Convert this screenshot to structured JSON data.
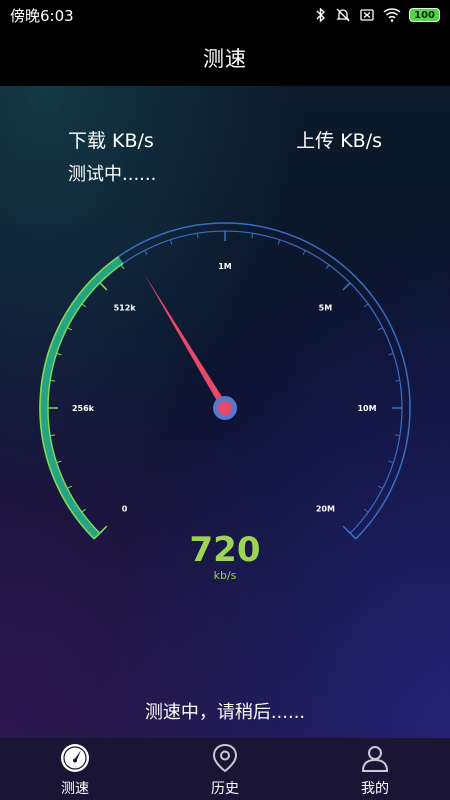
{
  "status_bar": {
    "time": "傍晚6:03",
    "battery": "100",
    "icons": [
      "bluetooth-icon",
      "mute-icon",
      "sim-off-icon",
      "wifi-icon",
      "battery-icon"
    ]
  },
  "header": {
    "title": "测速"
  },
  "speed_panel": {
    "download_label": "下载 KB/s",
    "upload_label": "上传 KB/s",
    "testing_text": "测试中......"
  },
  "gauge": {
    "scale_labels": [
      "0",
      "256k",
      "512k",
      "1M",
      "5M",
      "10M",
      "20M"
    ],
    "needle_fraction": 0.385,
    "progress_fraction": 0.37,
    "colors": {
      "progress": "#27b38a",
      "ring": "#3a6ec0",
      "needle": "#e64a68",
      "hub": "#5b76c8"
    }
  },
  "speed": {
    "value": "720",
    "unit": "kb/s"
  },
  "footer_status": "测速中，请稍后......",
  "tabs": [
    {
      "label": "测速",
      "icon": "speedometer-icon",
      "active": true
    },
    {
      "label": "历史",
      "icon": "location-pin-icon",
      "active": false
    },
    {
      "label": "我的",
      "icon": "user-icon",
      "active": false
    }
  ]
}
